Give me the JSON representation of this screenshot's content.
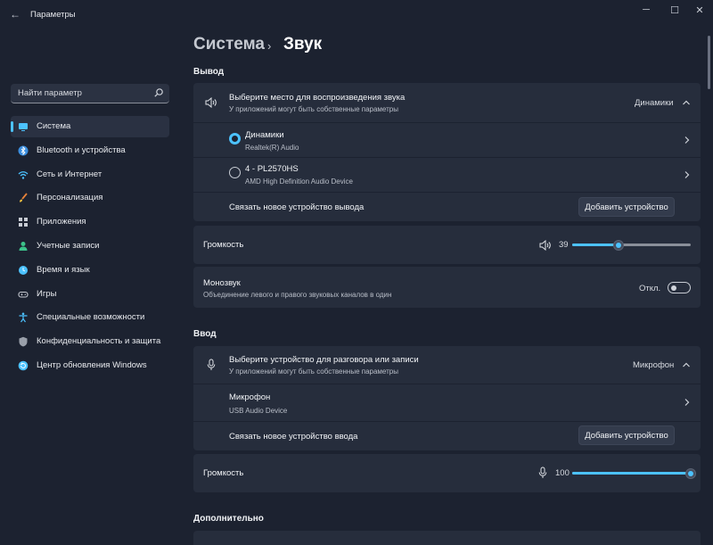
{
  "window": {
    "title": "Параметры",
    "back": "←",
    "minimize": "─",
    "maximize": "☐",
    "close": "✕"
  },
  "search": {
    "placeholder": "Найти параметр"
  },
  "breadcrumb": {
    "parent": "Система",
    "separator": "›",
    "current": "Звук"
  },
  "sidebar": {
    "items": [
      {
        "label": "Система",
        "icon": "monitor-icon",
        "color": "#4cc2ff"
      },
      {
        "label": "Bluetooth и устройства",
        "icon": "bluetooth-icon",
        "color": "#3a8dde"
      },
      {
        "label": "Сеть и Интернет",
        "icon": "wifi-icon",
        "color": "#4cc2ff"
      },
      {
        "label": "Персонализация",
        "icon": "brush-icon",
        "color": "#e8833a"
      },
      {
        "label": "Приложения",
        "icon": "apps-icon",
        "color": "#c8ccd4"
      },
      {
        "label": "Учетные записи",
        "icon": "account-icon",
        "color": "#3cc28a"
      },
      {
        "label": "Время и язык",
        "icon": "globe-clock-icon",
        "color": "#4cc2ff"
      },
      {
        "label": "Игры",
        "icon": "gamepad-icon",
        "color": "#c8ccd4"
      },
      {
        "label": "Специальные возможности",
        "icon": "accessibility-icon",
        "color": "#4cc2ff"
      },
      {
        "label": "Конфиденциальность и защита",
        "icon": "shield-icon",
        "color": "#9aa0aa"
      },
      {
        "label": "Центр обновления Windows",
        "icon": "update-icon",
        "color": "#4cc2ff"
      }
    ]
  },
  "output": {
    "heading": "Вывод",
    "chooser": {
      "title": "Выберите место для воспроизведения звука",
      "subtitle": "У приложений могут быть собственные параметры",
      "value": "Динамики"
    },
    "devices": [
      {
        "name": "Динамики",
        "detail": "Realtek(R) Audio",
        "selected": true
      },
      {
        "name": "4 - PL2570HS",
        "detail": "AMD High Definition Audio Device",
        "selected": false
      }
    ],
    "pair": {
      "label": "Связать новое устройство вывода",
      "button": "Добавить устройство"
    },
    "volume": {
      "label": "Громкость",
      "value": "39",
      "level": 0.39
    },
    "mono": {
      "title": "Монозвук",
      "subtitle": "Объединение левого и правого звуковых каналов в один",
      "state": "Откл."
    }
  },
  "input": {
    "heading": "Ввод",
    "chooser": {
      "title": "Выберите устройство для разговора или записи",
      "subtitle": "У приложений могут быть собственные параметры",
      "value": "Микрофон"
    },
    "devices": [
      {
        "name": "Микрофон",
        "detail": "USB Audio Device"
      }
    ],
    "pair": {
      "label": "Связать новое устройство ввода",
      "button": "Добавить устройство"
    },
    "volume": {
      "label": "Громкость",
      "value": "100",
      "level": 1.0
    }
  },
  "advanced": {
    "heading": "Дополнительно"
  },
  "colors": {
    "accent": "#4cc2ff",
    "background": "#1c2230",
    "card": "#262d3c"
  }
}
